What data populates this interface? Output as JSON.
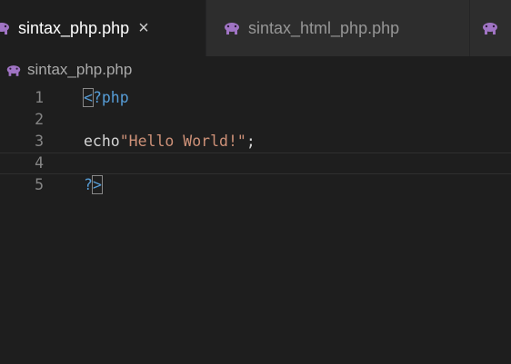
{
  "tabs": [
    {
      "label": "sintax_php.php",
      "close": "×",
      "active": true
    },
    {
      "label": "sintax_html_php.php",
      "active": false
    },
    {
      "label": "",
      "active": false
    }
  ],
  "breadcrumb": {
    "file": "sintax_php.php"
  },
  "editor": {
    "lines": [
      {
        "number": "1",
        "open_bracket": "<",
        "rest": "?php"
      },
      {
        "number": "2"
      },
      {
        "number": "3",
        "keyword": "echo",
        "string": "\"Hello World!\"",
        "semicolon": ";"
      },
      {
        "number": "4"
      },
      {
        "number": "5",
        "question": "?",
        "close_bracket": ">"
      }
    ],
    "current_line": 4
  },
  "colors": {
    "background": "#1e1e1e",
    "tag": "#569cd6",
    "string": "#ce9178",
    "line_number": "#858585",
    "php_icon": "#a074c4"
  },
  "icons": {
    "tab_file_icon": "php-elephant-icon",
    "close_icon": "close-icon"
  }
}
